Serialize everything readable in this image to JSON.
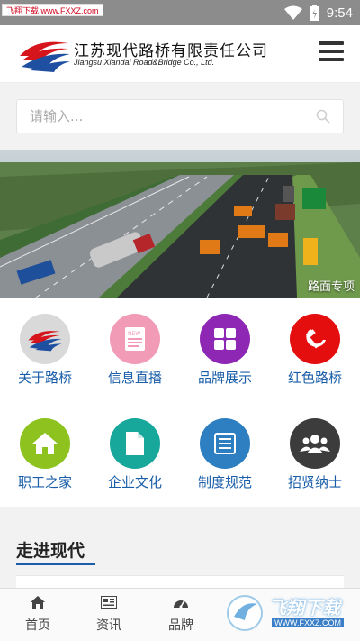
{
  "statusbar": {
    "watermark": "飞翔下载 www.FXXZ.com",
    "time": "9:54"
  },
  "header": {
    "logo_cn": "江苏现代路桥有限责任公司",
    "logo_en": "Jiangsu Xiandai Road&Bridge Co., Ltd."
  },
  "search": {
    "placeholder": "请输入..."
  },
  "banner": {
    "caption": "路面专项"
  },
  "grid": {
    "items": [
      {
        "label": "关于路桥",
        "color": "#d9d9d9",
        "icon": "company-logo-icon"
      },
      {
        "label": "信息直播",
        "color": "#f29bb7",
        "icon": "news-icon"
      },
      {
        "label": "品牌展示",
        "color": "#8e27b3",
        "icon": "windows-grid-icon"
      },
      {
        "label": "红色路桥",
        "color": "#e50e0e",
        "icon": "hammer-sickle-icon"
      },
      {
        "label": "职工之家",
        "color": "#8dc21f",
        "icon": "home-icon"
      },
      {
        "label": "企业文化",
        "color": "#17a79b",
        "icon": "document-icon"
      },
      {
        "label": "制度规范",
        "color": "#2d7fc1",
        "icon": "list-document-icon"
      },
      {
        "label": "招贤纳士",
        "color": "#3c3c3c",
        "icon": "group-icon"
      }
    ]
  },
  "section": {
    "title": "走进现代"
  },
  "bottomnav": {
    "items": [
      {
        "label": "首页",
        "icon": "home-icon"
      },
      {
        "label": "资讯",
        "icon": "newspaper-icon"
      },
      {
        "label": "品牌",
        "icon": "dashboard-icon"
      }
    ]
  },
  "watermark_br": {
    "text": "飞翔下载",
    "url": "WWW.FXXZ.COM"
  }
}
